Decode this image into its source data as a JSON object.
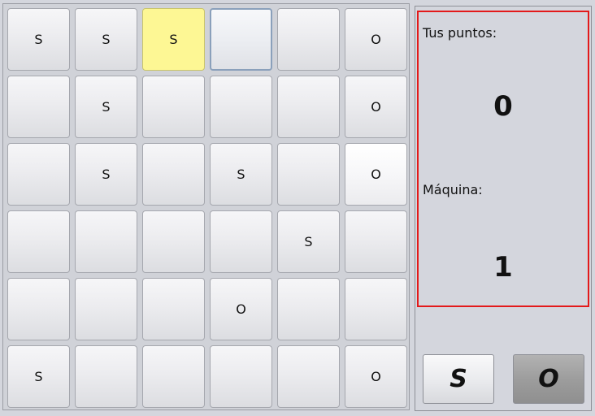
{
  "board": {
    "rows": [
      [
        {
          "v": "S",
          "style": "normal"
        },
        {
          "v": "S",
          "style": "normal"
        },
        {
          "v": "S",
          "style": "highlight"
        },
        {
          "v": "",
          "style": "hover"
        },
        {
          "v": "",
          "style": "normal"
        },
        {
          "v": "O",
          "style": "normal"
        }
      ],
      [
        {
          "v": "",
          "style": "normal"
        },
        {
          "v": "S",
          "style": "normal"
        },
        {
          "v": "",
          "style": "normal"
        },
        {
          "v": "",
          "style": "normal"
        },
        {
          "v": "",
          "style": "normal"
        },
        {
          "v": "O",
          "style": "normal"
        }
      ],
      [
        {
          "v": "",
          "style": "normal"
        },
        {
          "v": "S",
          "style": "normal"
        },
        {
          "v": "",
          "style": "normal"
        },
        {
          "v": "S",
          "style": "normal"
        },
        {
          "v": "",
          "style": "normal"
        },
        {
          "v": "O",
          "style": "bright"
        }
      ],
      [
        {
          "v": "",
          "style": "normal"
        },
        {
          "v": "",
          "style": "normal"
        },
        {
          "v": "",
          "style": "normal"
        },
        {
          "v": "",
          "style": "normal"
        },
        {
          "v": "S",
          "style": "normal"
        },
        {
          "v": "",
          "style": "normal"
        }
      ],
      [
        {
          "v": "",
          "style": "normal"
        },
        {
          "v": "",
          "style": "normal"
        },
        {
          "v": "",
          "style": "normal"
        },
        {
          "v": "O",
          "style": "normal"
        },
        {
          "v": "",
          "style": "normal"
        },
        {
          "v": "",
          "style": "normal"
        }
      ],
      [
        {
          "v": "S",
          "style": "normal"
        },
        {
          "v": "",
          "style": "normal"
        },
        {
          "v": "",
          "style": "normal"
        },
        {
          "v": "",
          "style": "normal"
        },
        {
          "v": "",
          "style": "normal"
        },
        {
          "v": "O",
          "style": "normal"
        }
      ]
    ]
  },
  "score": {
    "player_label": "Tus puntos:",
    "player_points": "0",
    "machine_label": "Máquina:",
    "machine_points": "1",
    "border_color": "#e31a1a"
  },
  "letter_buttons": {
    "s_label": "S",
    "o_label": "O",
    "selected": "O"
  }
}
